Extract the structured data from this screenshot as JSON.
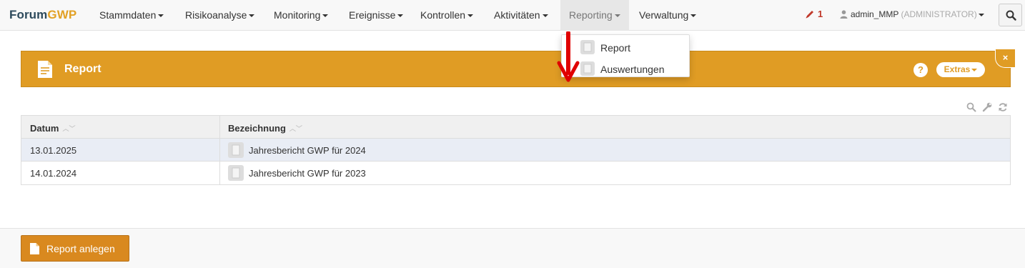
{
  "brand": {
    "part1": "Forum",
    "part2": "GWP"
  },
  "nav": {
    "items": [
      {
        "label": "Stammdaten"
      },
      {
        "label": "Risikoanalyse"
      },
      {
        "label": "Monitoring"
      },
      {
        "label": "Ereignisse"
      },
      {
        "label": "Kontrollen"
      },
      {
        "label": "Aktivitäten"
      },
      {
        "label": "Reporting"
      },
      {
        "label": "Verwaltung"
      }
    ],
    "active": "Reporting",
    "notifications": "1",
    "user_name": "admin_MMP",
    "user_role": "(ADMINISTRATOR)"
  },
  "dropdown": {
    "items": [
      {
        "label": "Report"
      },
      {
        "label": "Auswertungen"
      }
    ]
  },
  "panel": {
    "title": "Report",
    "help": "?",
    "extras_label": "Extras",
    "close": "×"
  },
  "table": {
    "columns": [
      "Datum",
      "Bezeichnung"
    ],
    "rows": [
      {
        "date": "13.01.2025",
        "name": "Jahresbericht GWP für 2024"
      },
      {
        "date": "14.01.2024",
        "name": "Jahresbericht GWP für 2023"
      }
    ]
  },
  "footer": {
    "add_label": "Report anlegen"
  },
  "colors": {
    "accent": "#e09c24",
    "button": "#d9891f",
    "brand_dark": "#2d4a5c",
    "alert": "#c0392b",
    "arrow": "#e00000"
  }
}
